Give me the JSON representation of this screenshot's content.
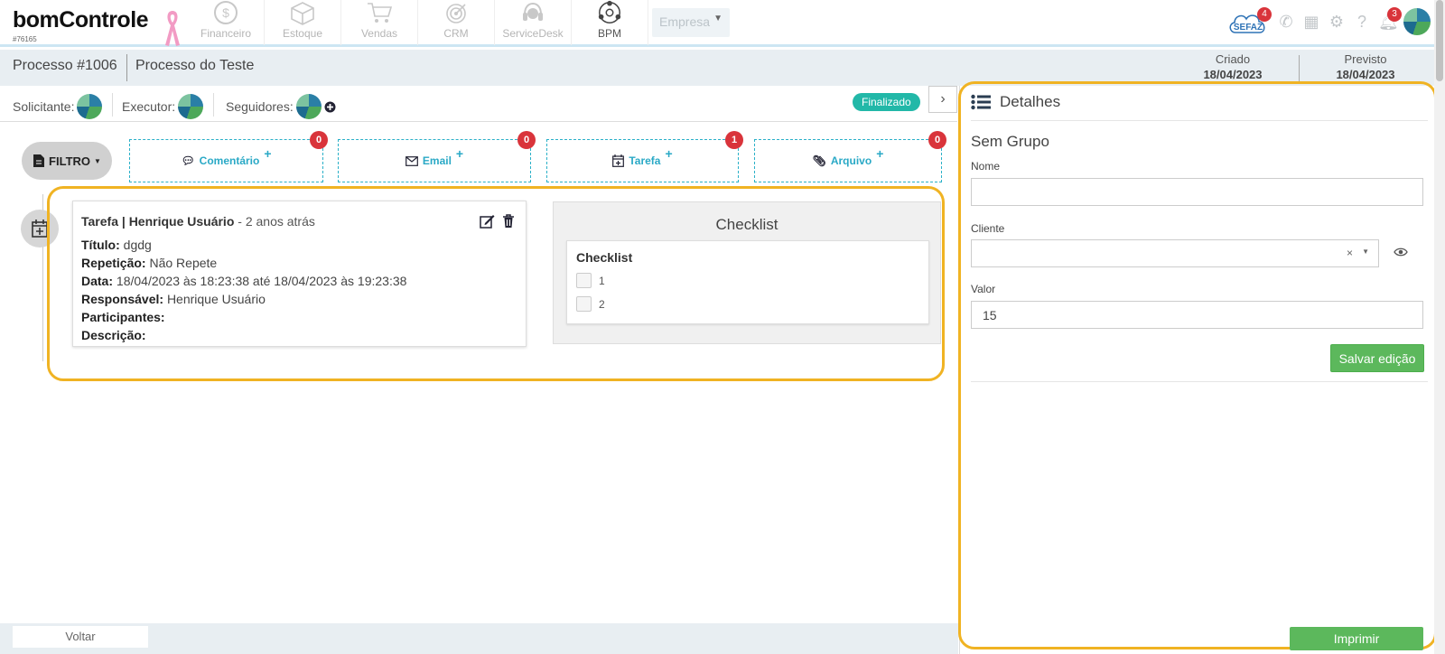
{
  "header": {
    "logo_text": "bomControle",
    "account_id": "#76165",
    "modules": [
      {
        "label": "Financeiro",
        "icon": "dollar-circle-icon"
      },
      {
        "label": "Estoque",
        "icon": "box-icon"
      },
      {
        "label": "Vendas",
        "icon": "cart-icon"
      },
      {
        "label": "CRM",
        "icon": "target-icon"
      },
      {
        "label": "ServiceDesk",
        "icon": "headset-icon"
      },
      {
        "label": "BPM",
        "icon": "network-icon",
        "active": true
      }
    ],
    "company_select": "Empresa",
    "sefaz_label": "SEFAZ",
    "sefaz_badge": "4",
    "notifications_badge": "3"
  },
  "process": {
    "number": "Processo #1006",
    "name": "Processo do Teste",
    "created_label": "Criado",
    "created_date": "18/04/2023",
    "expected_label": "Previsto",
    "expected_date": "18/04/2023"
  },
  "people": {
    "requester_label": "Solicitante:",
    "executor_label": "Executor:",
    "followers_label": "Seguidores:",
    "status": "Finalizado"
  },
  "toolbar": {
    "filter_label": "FILTRO",
    "actions": [
      {
        "label": "Comentário",
        "count": "0",
        "icon": "comment-icon"
      },
      {
        "label": "Email",
        "count": "0",
        "icon": "envelope-icon"
      },
      {
        "label": "Tarefa",
        "count": "1",
        "icon": "calendar-plus-icon"
      },
      {
        "label": "Arquivo",
        "count": "0",
        "icon": "paperclip-icon"
      }
    ]
  },
  "task": {
    "type": "Tarefa",
    "author": "Henrique Usuário",
    "time_ago": "- 2 anos atrás",
    "title_label": "Título:",
    "title_value": "dgdg",
    "repeat_label": "Repetição:",
    "repeat_value": "Não Repete",
    "date_label": "Data:",
    "date_value": "18/04/2023 às 18:23:38 até 18/04/2023 às 19:23:38",
    "responsible_label": "Responsável:",
    "responsible_value": "Henrique Usuário",
    "participants_label": "Participantes:",
    "description_label": "Descrição:"
  },
  "checklist": {
    "panel_title": "Checklist",
    "inner_title": "Checklist",
    "items": [
      "1",
      "2"
    ]
  },
  "details": {
    "title": "Detalhes",
    "group": "Sem Grupo",
    "name_label": "Nome",
    "name_value": "",
    "client_label": "Cliente",
    "value_label": "Valor",
    "value_value": "15",
    "save_button": "Salvar edição",
    "print_button": "Imprimir"
  },
  "footer": {
    "back_button": "Voltar"
  }
}
